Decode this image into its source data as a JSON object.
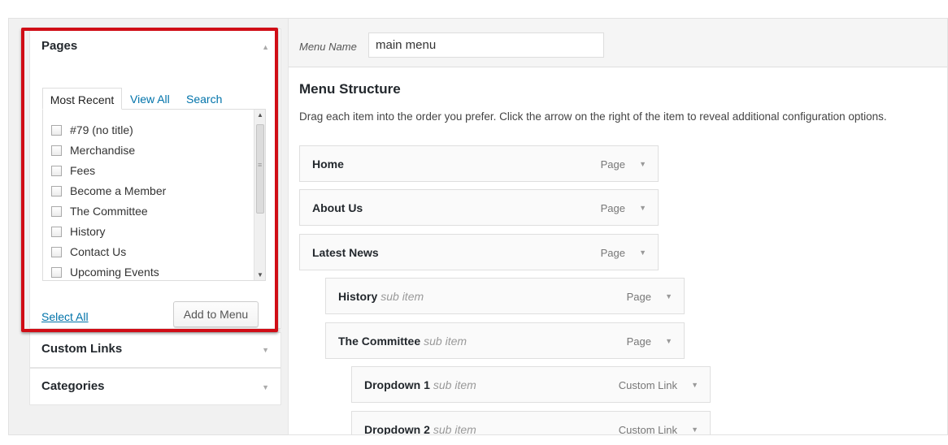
{
  "sidebar": {
    "pages_box": {
      "title": "Pages",
      "tabs": [
        "Most Recent",
        "View All",
        "Search"
      ],
      "items": [
        "#79 (no title)",
        "Merchandise",
        "Fees",
        "Become a Member",
        "The Committee",
        "History",
        "Contact Us",
        "Upcoming Events"
      ],
      "select_all": "Select All",
      "add_to_menu": "Add to Menu"
    },
    "custom_links": {
      "title": "Custom Links"
    },
    "categories": {
      "title": "Categories"
    }
  },
  "menu": {
    "name_label": "Menu Name",
    "name_value": "main menu",
    "structure_title": "Menu Structure",
    "structure_help": "Drag each item into the order you prefer. Click the arrow on the right of the item to reveal additional configuration options.",
    "items": [
      {
        "title": "Home",
        "sub": "",
        "type": "Page"
      },
      {
        "title": "About Us",
        "sub": "",
        "type": "Page"
      },
      {
        "title": "Latest News",
        "sub": "",
        "type": "Page"
      },
      {
        "title": "History",
        "sub": "sub item",
        "type": "Page"
      },
      {
        "title": "The Committee",
        "sub": "sub item",
        "type": "Page"
      },
      {
        "title": "Dropdown 1",
        "sub": "sub item",
        "type": "Custom Link"
      },
      {
        "title": "Dropdown 2",
        "sub": "sub item",
        "type": "Custom Link"
      }
    ]
  },
  "colors": {
    "highlight": "#d00d16",
    "link": "#0073aa"
  }
}
